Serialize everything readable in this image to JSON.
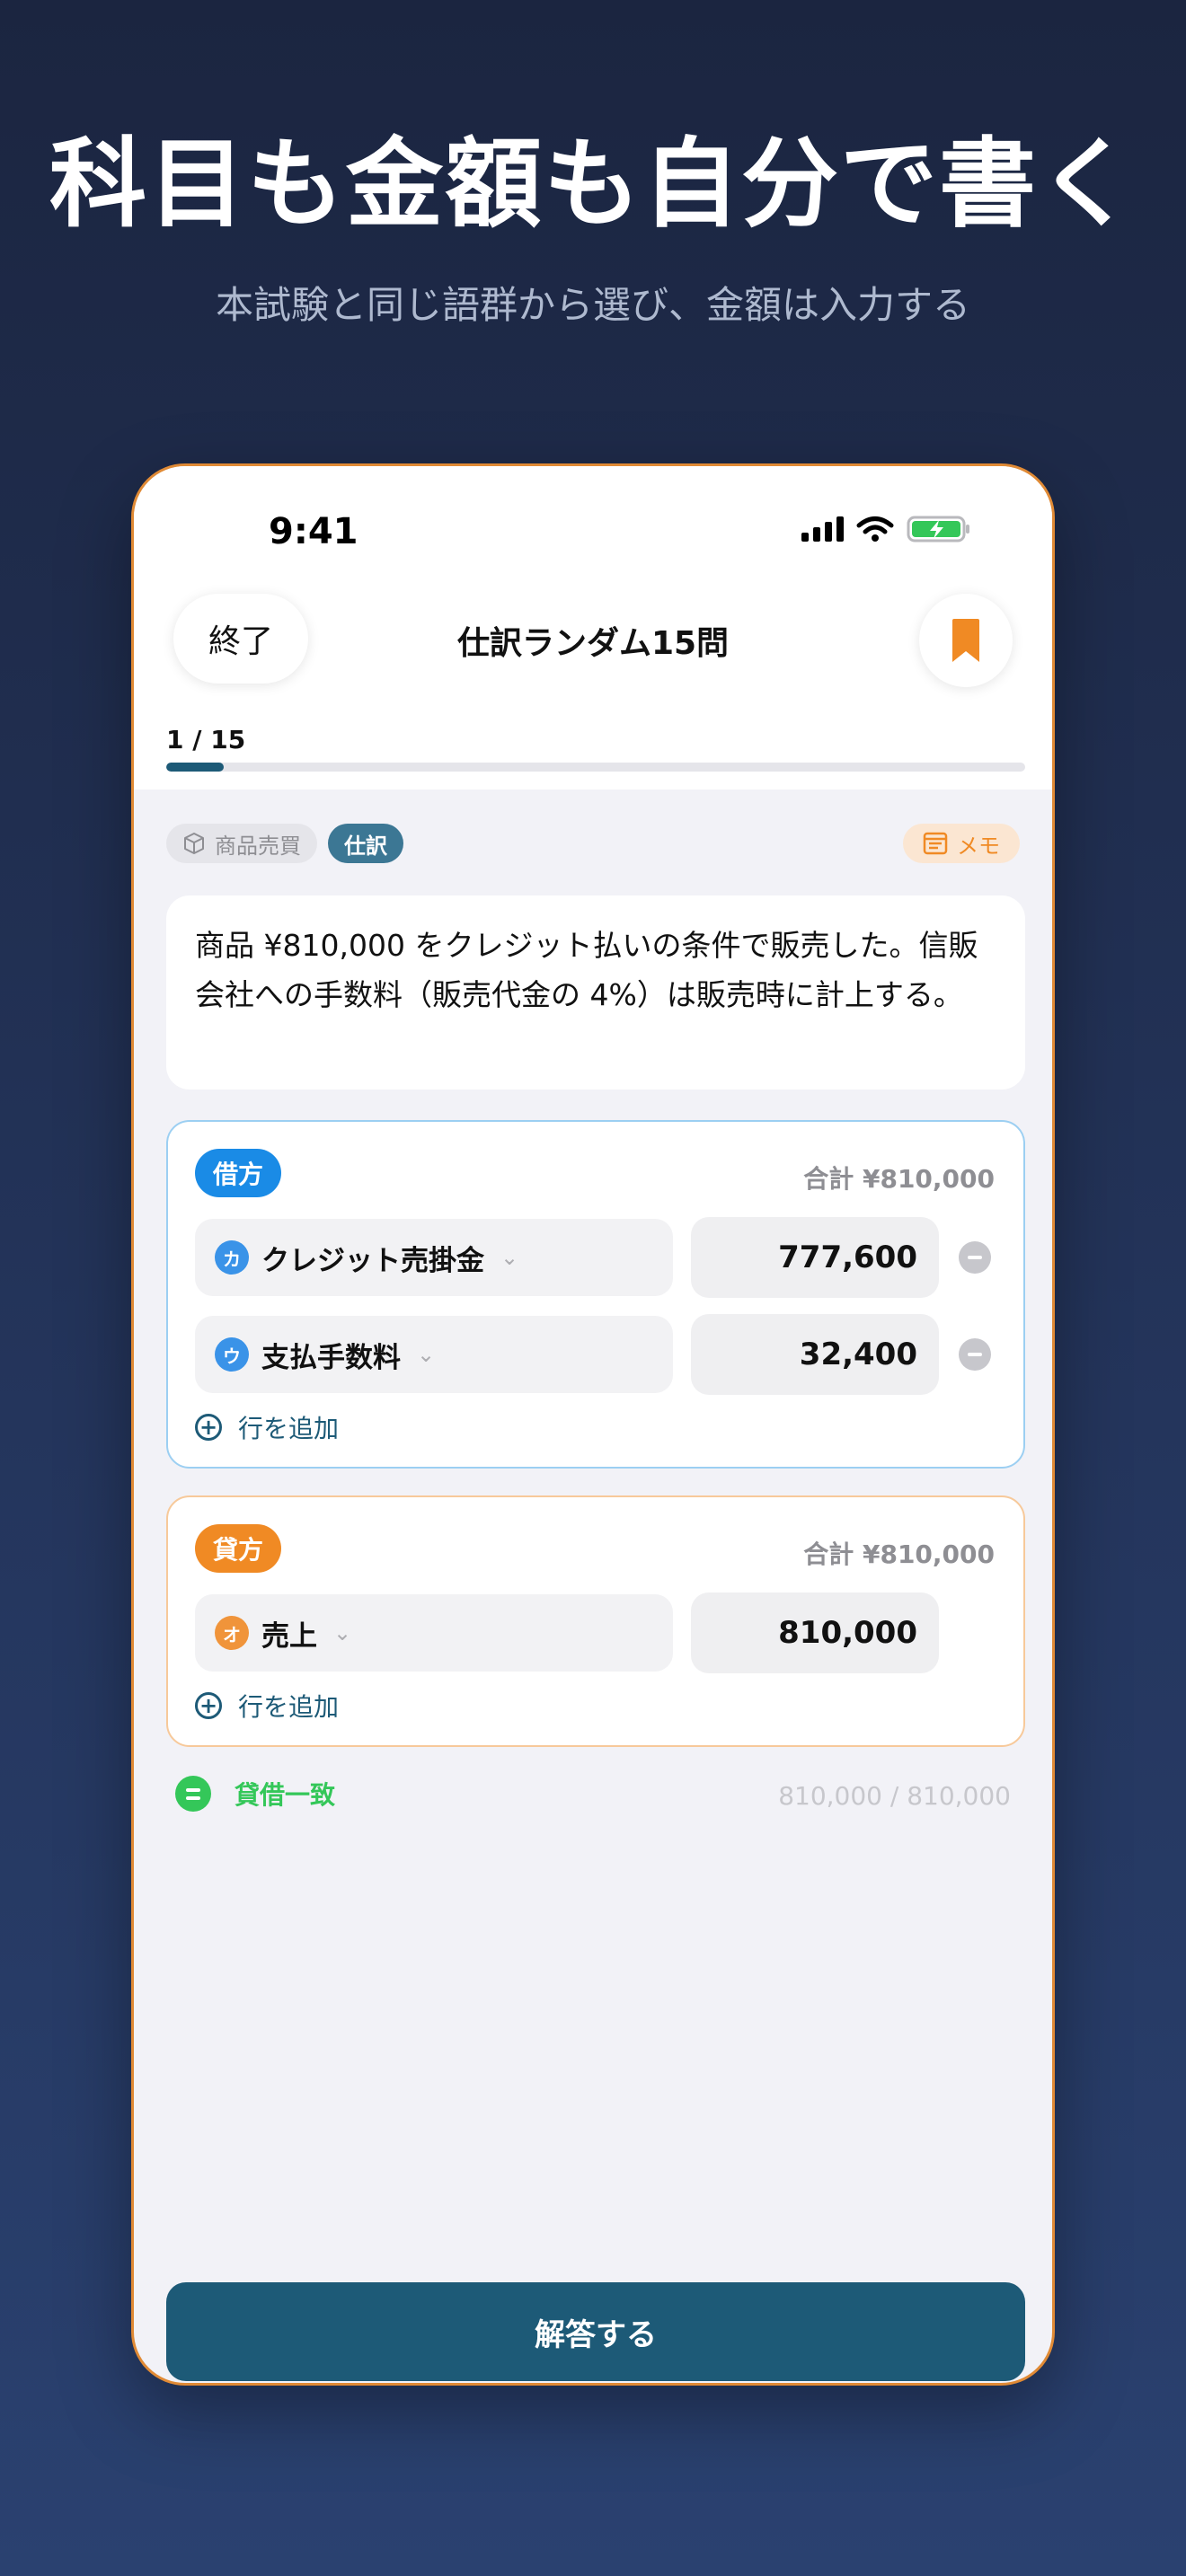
{
  "hero": {
    "headline": "科目も金額も自分で書く",
    "subline": "本試験と同じ語群から選び、金額は入力する"
  },
  "status_bar": {
    "time": "9:41"
  },
  "nav": {
    "end_label": "終了",
    "title": "仕訳ランダム15問",
    "bookmark_icon": "bookmark-icon"
  },
  "progress": {
    "label": "1 / 15",
    "fraction": 0.0667
  },
  "tags": {
    "category": "商品売買",
    "type": "仕訳"
  },
  "memo_label": "メモ",
  "question": "商品 ¥810,000 をクレジット払いの条件で販売した。信販会社への手数料（販売代金の 4%）は販売時に計上する。",
  "debit": {
    "label": "借方",
    "total": "合計 ¥810,000",
    "rows": [
      {
        "badge": "カ",
        "account": "クレジット売掛金",
        "amount": "777,600"
      },
      {
        "badge": "ウ",
        "account": "支払手数料",
        "amount": "32,400"
      }
    ],
    "add_label": "行を追加"
  },
  "credit": {
    "label": "貸方",
    "total": "合計 ¥810,000",
    "rows": [
      {
        "badge": "オ",
        "account": "売上",
        "amount": "810,000"
      }
    ],
    "add_label": "行を追加"
  },
  "balance": {
    "label": "貸借一致",
    "values": "810,000 / 810,000"
  },
  "answer_label": "解答する",
  "colors": {
    "accent": "#1d5a77",
    "debit": "#1a8be6",
    "credit": "#f08a24",
    "balanced": "#34c759"
  }
}
